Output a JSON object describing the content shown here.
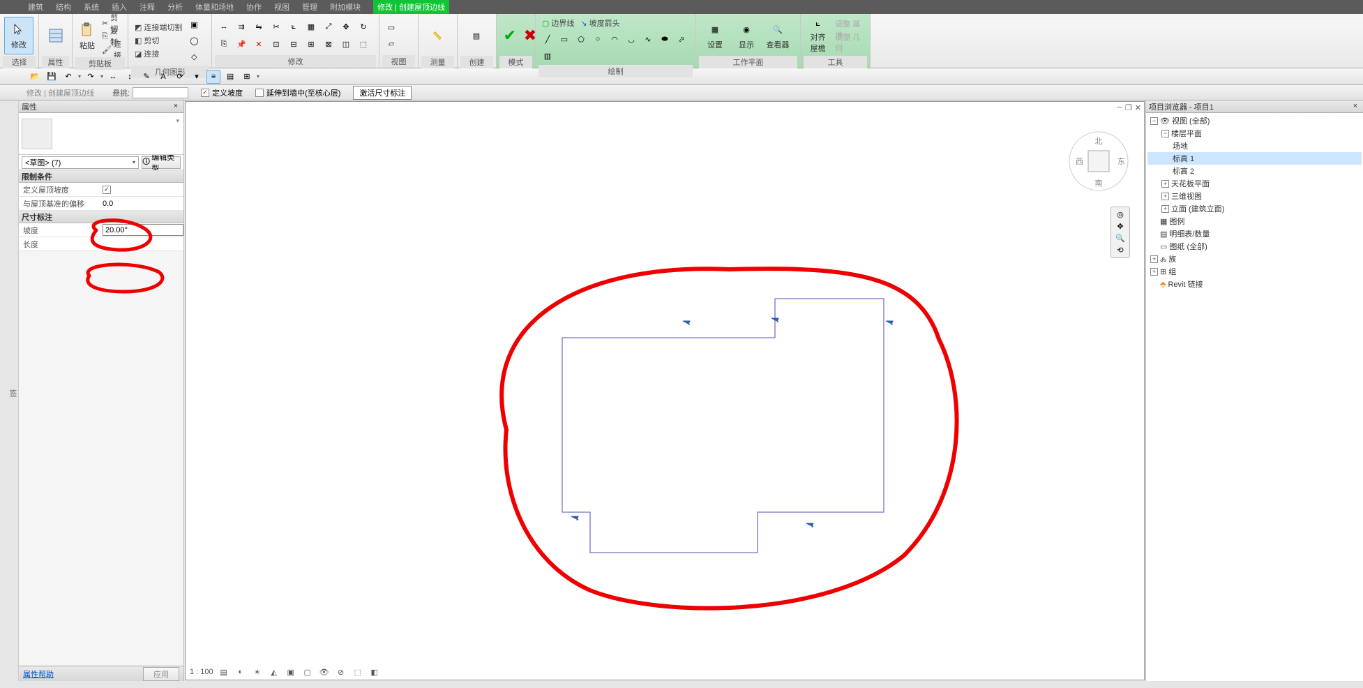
{
  "menu": [
    "建筑",
    "结构",
    "系统",
    "插入",
    "注释",
    "分析",
    "体量和场地",
    "协作",
    "视图",
    "管理",
    "附加模块",
    "修改 | 创建屋顶边线"
  ],
  "ribbon_tabs": {
    "t1": "修改",
    "t2": "创建屋顶边线"
  },
  "groups": {
    "select": "选择",
    "props": "属性",
    "clip": "剪贴板",
    "geom": "几何图形",
    "modify": "修改",
    "view": "视图",
    "measure": "测量",
    "create": "创建",
    "mode": "模式",
    "draw": "绘制",
    "wplane": "工作平面",
    "tools": "工具"
  },
  "btns": {
    "modify": "修改",
    "paste": "粘贴",
    "cut_g": "剪切",
    "copy_g": "复制",
    "join": "连接",
    "settings": "设置",
    "show": "显示",
    "viewer": "查看器",
    "align": "对齐\n屋檐",
    "boundary": "边界线",
    "slope": "坡度箭头",
    "tool_a": "调整 基准",
    "tool_b": "调整 几何",
    "join_cut": "连接端切割"
  },
  "opt": {
    "tab": "修改 | 创建屋顶边线",
    "pick": "悬挑:",
    "def_slope": "定义坡度",
    "extend": "延伸到墙中(至核心层)",
    "activate": "激活尺寸标注"
  },
  "panels": {
    "props": "属性",
    "browser": "项目浏览器 - 项目1"
  },
  "type": {
    "combo": "<草图> (7)",
    "edit": "编辑类型"
  },
  "prop_groups": {
    "constraints": "限制条件",
    "dims": "尺寸标注"
  },
  "props": {
    "def_slope": "定义屋顶坡度",
    "offset": "与屋顶基准的偏移",
    "offset_v": "0.0",
    "slope": "坡度",
    "length": "长度"
  },
  "slope_value": "20.00°",
  "footer": {
    "help": "属性帮助",
    "apply": "应用"
  },
  "tree": {
    "root": "视图 (全部)",
    "floor": "楼层平面",
    "site": "场地",
    "l1": "标高 1",
    "l2": "标高 2",
    "ceil": "天花板平面",
    "v3d": "三维视图",
    "elev": "立面 (建筑立面)",
    "legend": "图例",
    "sched": "明细表/数量",
    "sheet": "图纸 (全部)",
    "fam": "族",
    "group": "组",
    "link": "Revit 链接"
  },
  "viewctrl": {
    "scale": "1 : 100"
  },
  "sig": "签"
}
